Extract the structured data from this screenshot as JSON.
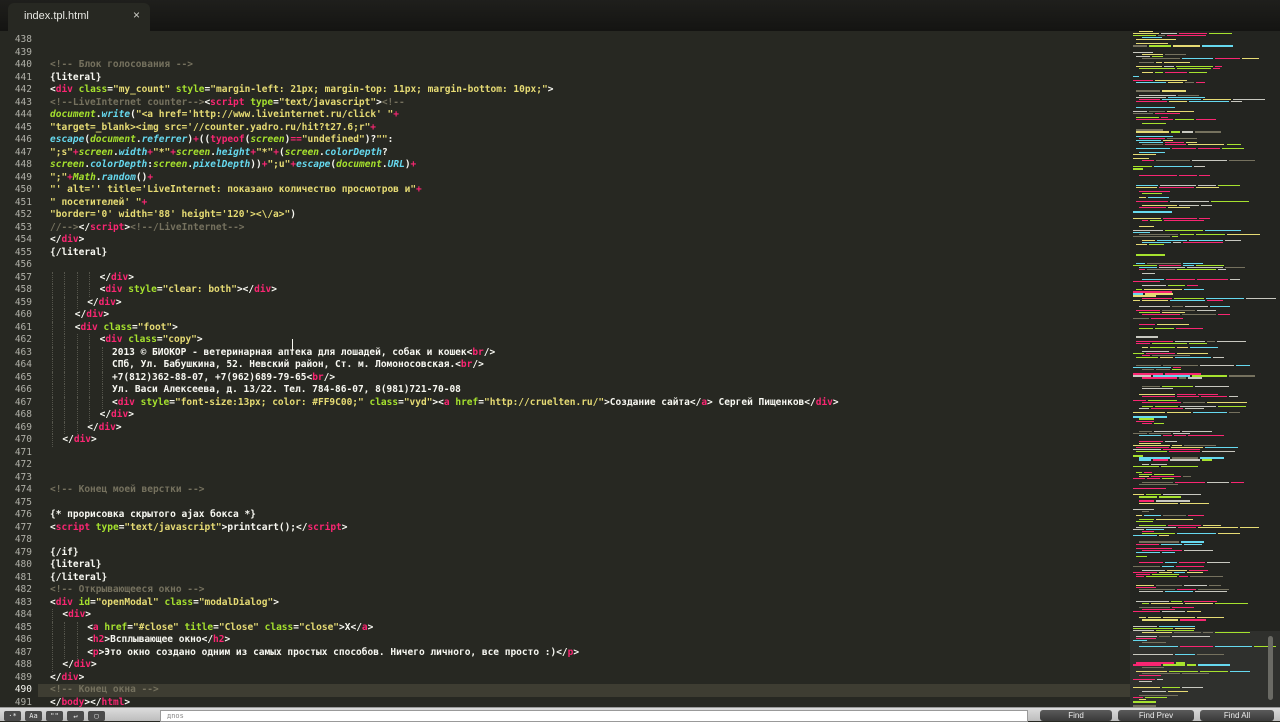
{
  "tab": {
    "title": "index.tpl.html",
    "close": "×"
  },
  "editor": {
    "current_line": 490,
    "lines": [
      {
        "n": 438,
        "i": 0,
        "h": ""
      },
      {
        "n": 439,
        "i": 0,
        "h": ""
      },
      {
        "n": 440,
        "i": 0,
        "h": "<span class=\"c\">&lt;!-- Блок голосования --&gt;</span>"
      },
      {
        "n": 441,
        "i": 0,
        "h": "{literal}"
      },
      {
        "n": 442,
        "i": 0,
        "h": "&lt;<span class=\"t\">div</span> <span class=\"a\">class</span>=<span class=\"s\">\"my_count\"</span> <span class=\"a\">style</span>=<span class=\"s\">\"margin-left: 21px; margin-top: 11px; margin-bottom: 10px;\"</span>&gt;"
      },
      {
        "n": 443,
        "i": 0,
        "h": "<span class=\"c\">&lt;!--LiveInternet counter--&gt;</span>&lt;<span class=\"t\">script</span> <span class=\"a\">type</span>=<span class=\"s\">\"text/javascript\"</span>&gt;<span class=\"c\">&lt;!--</span>"
      },
      {
        "n": 444,
        "i": 0,
        "h": "<span class=\"g\">document</span>.<span class=\"k\">write</span>(<span class=\"s\">\"&lt;a href='http://www.liveinternet.ru/click' \"</span><span class=\"t\">+</span>"
      },
      {
        "n": 445,
        "i": 0,
        "h": "<span class=\"s\">\"target=_blank&gt;&lt;img src='//counter.yadro.ru/hit?t27.6;r\"</span><span class=\"t\">+</span>"
      },
      {
        "n": 446,
        "i": 0,
        "h": "<span class=\"k\">escape</span>(<span class=\"g\">document</span>.<span class=\"k\">referrer</span>)<span class=\"t\">+</span>((<span class=\"t\">typeof</span>(<span class=\"g\">screen</span>)<span class=\"t\">==</span><span class=\"s\">\"undefined\"</span>)?<span class=\"s\">\"\"</span>:"
      },
      {
        "n": 447,
        "i": 0,
        "h": "<span class=\"s\">\";s\"</span><span class=\"t\">+</span><span class=\"g\">screen</span>.<span class=\"k\">width</span><span class=\"t\">+</span><span class=\"s\">\"*\"</span><span class=\"t\">+</span><span class=\"g\">screen</span>.<span class=\"k\">height</span><span class=\"t\">+</span><span class=\"s\">\"*\"</span><span class=\"t\">+</span>(<span class=\"g\">screen</span>.<span class=\"k\">colorDepth</span>?"
      },
      {
        "n": 448,
        "i": 0,
        "h": "<span class=\"g\">screen</span>.<span class=\"k\">colorDepth</span>:<span class=\"g\">screen</span>.<span class=\"k\">pixelDepth</span>))<span class=\"t\">+</span><span class=\"s\">\";u\"</span><span class=\"t\">+</span><span class=\"k\">escape</span>(<span class=\"g\">document</span>.<span class=\"k\">URL</span>)<span class=\"t\">+</span>"
      },
      {
        "n": 449,
        "i": 0,
        "h": "<span class=\"s\">\";\"</span><span class=\"t\">+</span><span class=\"g\">Math</span>.<span class=\"k\">random</span>()<span class=\"t\">+</span>"
      },
      {
        "n": 450,
        "i": 0,
        "h": "<span class=\"s\">\"' alt='' title='LiveInternet: показано количество просмотров и\"</span><span class=\"t\">+</span>"
      },
      {
        "n": 451,
        "i": 0,
        "h": "<span class=\"s\">\" посетителей' \"</span><span class=\"t\">+</span>"
      },
      {
        "n": 452,
        "i": 0,
        "h": "<span class=\"s\">\"border='0' width='88' height='120'&gt;&lt;\\/a&gt;\"</span>)"
      },
      {
        "n": 453,
        "i": 0,
        "h": "<span class=\"c\">//--&gt;</span>&lt;/<span class=\"t\">script</span>&gt;<span class=\"c\">&lt;!--/LiveInternet--&gt;</span>"
      },
      {
        "n": 454,
        "i": 0,
        "h": "&lt;/<span class=\"t\">div</span>&gt;"
      },
      {
        "n": 455,
        "i": 0,
        "h": "{/literal}"
      },
      {
        "n": 456,
        "i": 0,
        "h": ""
      },
      {
        "n": 457,
        "i": 4,
        "h": "&lt;/<span class=\"t\">div</span>&gt;"
      },
      {
        "n": 458,
        "i": 4,
        "h": "&lt;<span class=\"t\">div</span> <span class=\"a\">style</span>=<span class=\"s\">\"clear: both\"</span>&gt;&lt;/<span class=\"t\">div</span>&gt;"
      },
      {
        "n": 459,
        "i": 3,
        "h": "&lt;/<span class=\"t\">div</span>&gt;"
      },
      {
        "n": 460,
        "i": 2,
        "h": "&lt;/<span class=\"t\">div</span>&gt;"
      },
      {
        "n": 461,
        "i": 2,
        "h": "&lt;<span class=\"t\">div</span> <span class=\"a\">class</span>=<span class=\"s\">\"foot\"</span>&gt;"
      },
      {
        "n": 462,
        "i": 4,
        "h": "&lt;<span class=\"t\">div</span> <span class=\"a\">class</span>=<span class=\"s\">\"copy\"</span>&gt;"
      },
      {
        "n": 463,
        "i": 5,
        "h": "2013 © БИОКОР - ветеринарная аптека для лошадей, собак и кошек&lt;<span class=\"t\">br</span>/&gt;"
      },
      {
        "n": 464,
        "i": 5,
        "h": "СПб, Ул. Бабушкина, 52. Невский район, Ст. м. Ломоносовская.&lt;<span class=\"t\">br</span>/&gt;"
      },
      {
        "n": 465,
        "i": 5,
        "h": "+7(812)362-88-07, +7(962)689-79-65&lt;<span class=\"t\">br</span>/&gt;"
      },
      {
        "n": 466,
        "i": 5,
        "h": "Ул. Васи Алексеева, д. 13/22. Тел. 784-86-07, 8(981)721-70-08"
      },
      {
        "n": 467,
        "i": 5,
        "h": "&lt;<span class=\"t\">div</span> <span class=\"a\">style</span>=<span class=\"s\">\"font-size:13px; color: #FF9C00;\"</span> <span class=\"a\">class</span>=<span class=\"s\">\"vyd\"</span>&gt;&lt;<span class=\"t\">a</span> <span class=\"a\">href</span>=<span class=\"s\">\"http://cruelten.ru/\"</span>&gt;Создание сайта&lt;/<span class=\"t\">a</span>&gt; Сергей Пищенков&lt;/<span class=\"t\">div</span>&gt;"
      },
      {
        "n": 468,
        "i": 4,
        "h": "&lt;/<span class=\"t\">div</span>&gt;"
      },
      {
        "n": 469,
        "i": 3,
        "h": "&lt;/<span class=\"t\">div</span>&gt;"
      },
      {
        "n": 470,
        "i": 1,
        "h": "&lt;/<span class=\"t\">div</span>&gt;"
      },
      {
        "n": 471,
        "i": 0,
        "h": ""
      },
      {
        "n": 472,
        "i": 0,
        "h": ""
      },
      {
        "n": 473,
        "i": 0,
        "h": ""
      },
      {
        "n": 474,
        "i": 0,
        "h": "<span class=\"c\">&lt;!-- Конец моей верстки --&gt;</span>"
      },
      {
        "n": 475,
        "i": 0,
        "h": ""
      },
      {
        "n": 476,
        "i": 0,
        "h": "{* прорисовка скрытого ajax бокса *}"
      },
      {
        "n": 477,
        "i": 0,
        "h": "&lt;<span class=\"t\">script</span> <span class=\"a\">type</span>=<span class=\"s\">\"text/javascript\"</span>&gt;printcart();&lt;/<span class=\"t\">script</span>&gt;"
      },
      {
        "n": 478,
        "i": 0,
        "h": ""
      },
      {
        "n": 479,
        "i": 0,
        "h": "{/if}"
      },
      {
        "n": 480,
        "i": 0,
        "h": "{literal}"
      },
      {
        "n": 481,
        "i": 0,
        "h": "{/literal}"
      },
      {
        "n": 482,
        "i": 0,
        "h": "<span class=\"c\">&lt;!-- Открывающееся окно --&gt;</span>"
      },
      {
        "n": 483,
        "i": 0,
        "h": "&lt;<span class=\"t\">div</span> <span class=\"a\">id</span>=<span class=\"s\">\"openModal\"</span> <span class=\"a\">class</span>=<span class=\"s\">\"modalDialog\"</span>&gt;"
      },
      {
        "n": 484,
        "i": 1,
        "h": "&lt;<span class=\"t\">div</span>&gt;"
      },
      {
        "n": 485,
        "i": 3,
        "h": "&lt;<span class=\"t\">a</span> <span class=\"a\">href</span>=<span class=\"s\">\"#close\"</span> <span class=\"a\">title</span>=<span class=\"s\">\"Close\"</span> <span class=\"a\">class</span>=<span class=\"s\">\"close\"</span>&gt;X&lt;/<span class=\"t\">a</span>&gt;"
      },
      {
        "n": 486,
        "i": 3,
        "h": "&lt;<span class=\"t\">h2</span>&gt;Всплывающее окно&lt;/<span class=\"t\">h2</span>&gt;"
      },
      {
        "n": 487,
        "i": 3,
        "h": "&lt;<span class=\"t\">p</span>&gt;Это окно создано одним из самых простых способов. Ничего личного, все просто :)&lt;/<span class=\"t\">p</span>&gt;"
      },
      {
        "n": 488,
        "i": 1,
        "h": "&lt;/<span class=\"t\">div</span>&gt;"
      },
      {
        "n": 489,
        "i": 0,
        "h": "&lt;/<span class=\"t\">div</span>&gt;"
      },
      {
        "n": 490,
        "i": 0,
        "h": "<span class=\"c\">&lt;!-- Конец окна --&gt;</span>"
      },
      {
        "n": 491,
        "i": 0,
        "h": "&lt;/<span class=\"t\">body</span>&gt;&lt;/<span class=\"t\">html</span>&gt;"
      }
    ]
  },
  "findbar": {
    "placeholder": "дnos",
    "find": "Find",
    "find_prev": "Find Prev",
    "find_all": "Find All",
    "options": [
      "·*",
      "Aa",
      "\"\"",
      "↵",
      "▢"
    ]
  },
  "colors": {
    "background": "#272822",
    "tag": "#f92672",
    "attribute": "#a6e22e",
    "string": "#e6db74",
    "comment": "#75715e",
    "keyword": "#66d9ef"
  }
}
